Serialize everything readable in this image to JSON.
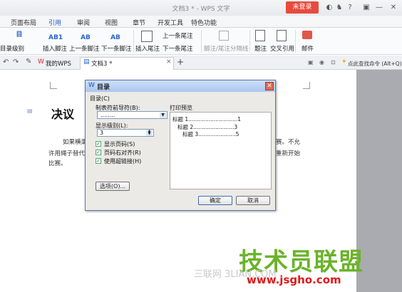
{
  "titlebar": {
    "title": "文档3 * - WPS 文字",
    "login": "未登录",
    "help": "?"
  },
  "menu": {
    "tabs": [
      "页面布局",
      "引用",
      "审阅",
      "视图",
      "章节",
      "开发工具",
      "特色功能"
    ]
  },
  "ribbon": {
    "level_label": "目录级别",
    "insert_footnote": "插入脚注",
    "prev_footnote": "上一条脚注",
    "next_footnote": "下一条脚注",
    "insert_endnote": "插入尾注",
    "prev_endnote": "上一条尾注",
    "next_endnote": "下一条尾注",
    "separator": "脚注/尾注分隔线",
    "caption": "题注",
    "cross_ref": "交叉引用",
    "mail": "邮件",
    "ab_icon": "AB",
    "ab1_icon": "AB1",
    "lbl_icon": "目"
  },
  "tabs": {
    "home": "我的WPS",
    "doc": "文档3 *",
    "search_hint": "点此查找命令 (Alt+Q)"
  },
  "doc": {
    "heading": "决议",
    "line1": "如果横渠",
    "line2": "许用绳子替代",
    "line3": "比赛。",
    "right1": "赛。不允",
    "right2": "重新开始"
  },
  "dialog": {
    "title": "目录",
    "group": "目录(C)",
    "leader_label": "制表符前导符(B):",
    "leader_value": "........",
    "level_label": "显示级别(L):",
    "level_value": "3",
    "show_page": "显示页码(S)",
    "right_align": "页码右对齐(R)",
    "hyperlink": "使用超链接(H)",
    "preview_label": "打印预览",
    "preview_lines": [
      "标题 1.............................1",
      "标题 2........................3",
      "标题 3......................5"
    ],
    "options": "选项(O)...",
    "ok": "确定",
    "cancel": "取消",
    "checks": [
      true,
      true,
      true
    ]
  },
  "watermark": {
    "main": "技术员联盟",
    "url": "www.jsgho.com",
    "site": "三联网 3LIAN.COM"
  }
}
